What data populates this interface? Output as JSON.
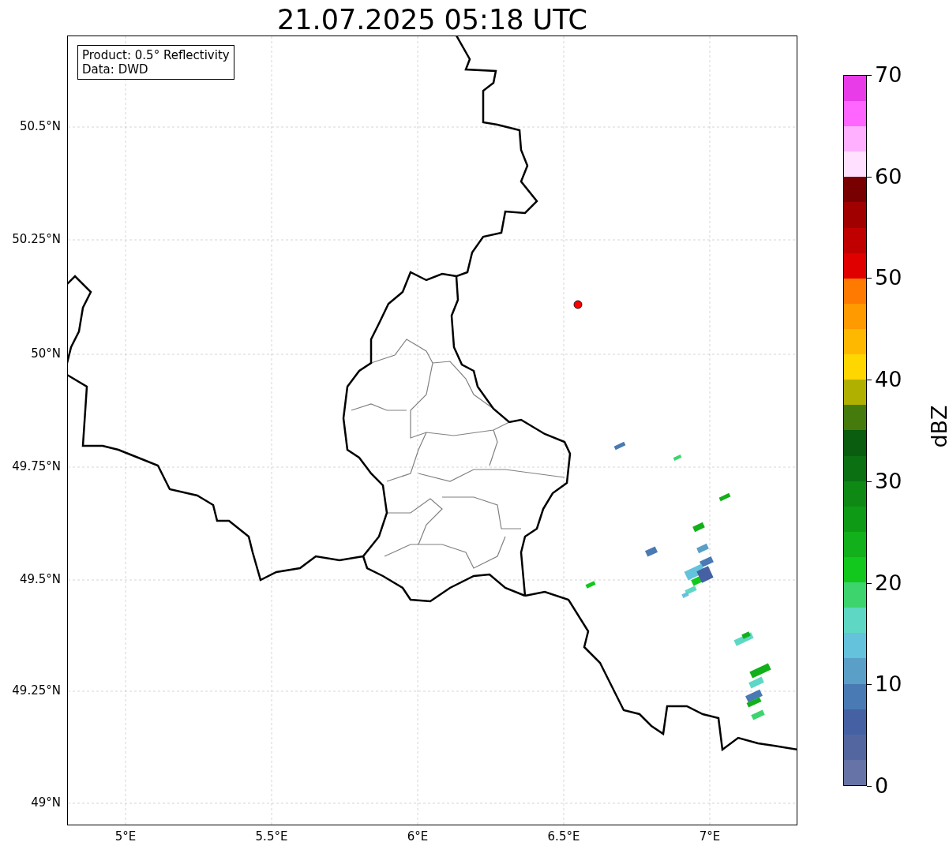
{
  "title": "21.07.2025 05:18 UTC",
  "legend": {
    "lines": [
      "Product: 0.5° Reflectivity",
      "Data: DWD"
    ]
  },
  "map": {
    "x_ticks": [
      "5°E",
      "5.5°E",
      "6°E",
      "6.5°E",
      "7°E"
    ],
    "y_ticks": [
      "50.5°N",
      "50.25°N",
      "50°N",
      "49.75°N",
      "49.5°N",
      "49.25°N",
      "49°N"
    ]
  },
  "colorbar": {
    "label": "dBZ",
    "ticks": [
      "70",
      "60",
      "50",
      "40",
      "30",
      "20",
      "10",
      "0"
    ],
    "segments": [
      {
        "color": "#6673a6"
      },
      {
        "color": "#5466a0"
      },
      {
        "color": "#4560a3"
      },
      {
        "color": "#4a7ab3"
      },
      {
        "color": "#5a9fc8"
      },
      {
        "color": "#64c2dc"
      },
      {
        "color": "#5ed8c4"
      },
      {
        "color": "#3dd46e"
      },
      {
        "color": "#12c81c"
      },
      {
        "color": "#12b01a"
      },
      {
        "color": "#0f9a16"
      },
      {
        "color": "#0e8a14"
      },
      {
        "color": "#0a7012"
      },
      {
        "color": "#0a5c0e"
      },
      {
        "color": "#457a0c"
      },
      {
        "color": "#b0b000"
      },
      {
        "color": "#ffd700"
      },
      {
        "color": "#ffb800"
      },
      {
        "color": "#ff9a00"
      },
      {
        "color": "#ff7a00"
      },
      {
        "color": "#e00000"
      },
      {
        "color": "#c00000"
      },
      {
        "color": "#a00000"
      },
      {
        "color": "#780000"
      },
      {
        "color": "#ffe0ff"
      },
      {
        "color": "#ffb0ff"
      },
      {
        "color": "#ff66ff"
      },
      {
        "color": "#e83ce8"
      }
    ]
  }
}
